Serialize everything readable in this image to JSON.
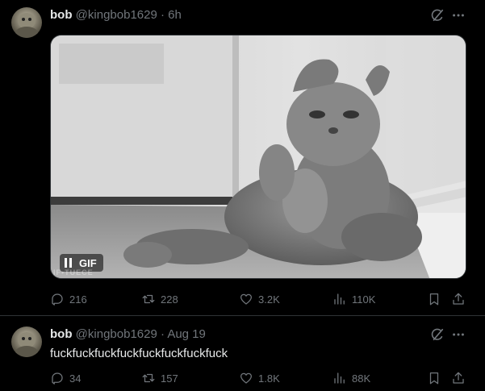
{
  "posts": [
    {
      "display_name": "bob",
      "handle": "@kingbob1629",
      "separator": "·",
      "time": "6h",
      "text": "",
      "media": {
        "type": "gif",
        "badge": "GIF",
        "watermark": "IF•TUECE"
      },
      "stats": {
        "replies": "216",
        "reposts": "228",
        "likes": "3.2K",
        "views": "110K"
      }
    },
    {
      "display_name": "bob",
      "handle": "@kingbob1629",
      "separator": "·",
      "time": "Aug 19",
      "text": "fuckfuckfuckfuckfuckfuckfuckfuck",
      "stats": {
        "replies": "34",
        "reposts": "157",
        "likes": "1.8K",
        "views": "88K"
      }
    }
  ],
  "colors": {
    "background": "#000000",
    "text": "#e7e9ea",
    "muted": "#71767b",
    "divider": "#2f3336"
  },
  "icons": [
    "grok-icon",
    "more-icon",
    "reply-icon",
    "retweet-icon",
    "like-icon",
    "views-icon",
    "bookmark-icon",
    "share-icon",
    "pause-icon"
  ]
}
